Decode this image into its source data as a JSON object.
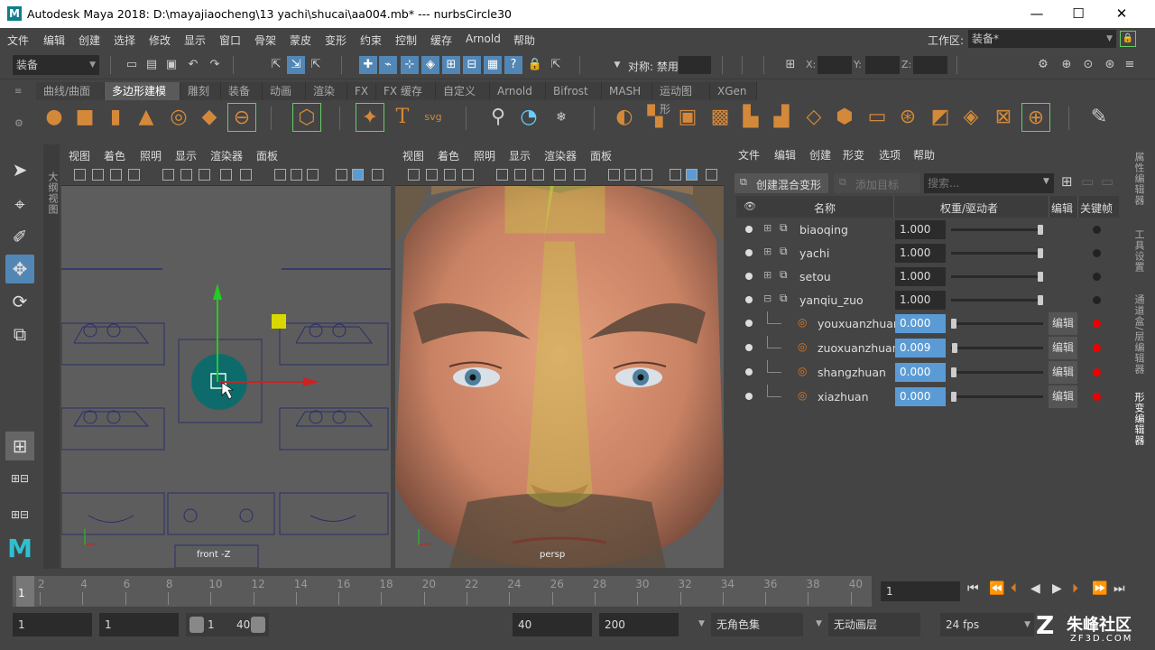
{
  "titlebar": {
    "logo": "M",
    "title": "Autodesk Maya 2018: D:\\mayajiaocheng\\13 yachi\\shucai\\aa004.mb*    ---    nurbsCircle30",
    "minimize": "—",
    "maximize": "☐",
    "close": "✕"
  },
  "menubar": {
    "items": [
      "文件",
      "编辑",
      "创建",
      "选择",
      "修改",
      "显示",
      "窗口",
      "骨架",
      "蒙皮",
      "变形",
      "约束",
      "控制",
      "缓存",
      "Arnold",
      "帮助"
    ],
    "workspace_label": "工作区:",
    "workspace_value": "装备*"
  },
  "statusline": {
    "mode": "装备",
    "symmetry_label": "对称: 禁用",
    "x_label": "X:",
    "y_label": "Y:",
    "z_label": "Z:"
  },
  "shelf": {
    "tabs": [
      "曲线/曲面",
      "多边形建模",
      "雕刻",
      "装备",
      "动画",
      "渲染",
      "FX",
      "FX 缓存",
      "自定义",
      "Arnold",
      "Bifrost",
      "MASH",
      "运动图形",
      "XGen"
    ],
    "active_tab": "多边形建模"
  },
  "viewport_menu": [
    "视图",
    "着色",
    "照明",
    "显示",
    "渲染器",
    "面板"
  ],
  "front_viewport": {
    "camera_label": "front -Z"
  },
  "persp_viewport": {
    "camera_label": "persp"
  },
  "blend_editor": {
    "menu": [
      "文件",
      "编辑",
      "创建",
      "形变",
      "选项",
      "帮助"
    ],
    "create_button": "创建混合变形",
    "add_target_button": "添加目标",
    "search_placeholder": "搜索...",
    "headers": {
      "name": "名称",
      "weight": "权重/驱动者",
      "edit": "编辑",
      "key": "关键帧"
    },
    "rows": [
      {
        "name": "biaoqing",
        "value": "1.000",
        "level": 1.0,
        "has_edit": false,
        "key": "off"
      },
      {
        "name": "yachi",
        "value": "1.000",
        "level": 1.0,
        "has_edit": false,
        "key": "off"
      },
      {
        "name": "setou",
        "value": "1.000",
        "level": 1.0,
        "has_edit": false,
        "key": "off"
      },
      {
        "name": "yanqiu_zuo",
        "value": "1.000",
        "level": 1.0,
        "has_edit": false,
        "key": "off"
      },
      {
        "name": "youxuanzhuan",
        "value": "0.000",
        "level": 0.0,
        "has_edit": true,
        "key": "on"
      },
      {
        "name": "zuoxuanzhuan",
        "value": "0.009",
        "level": 0.009,
        "has_edit": true,
        "key": "on"
      },
      {
        "name": "shangzhuan",
        "value": "0.000",
        "level": 0.0,
        "has_edit": true,
        "key": "on"
      },
      {
        "name": "xiazhuan",
        "value": "0.000",
        "level": 0.0,
        "has_edit": true,
        "key": "on"
      }
    ],
    "edit_label": "编辑"
  },
  "right_tabs": [
    "属性编辑器",
    "工具设置",
    "通道盒/层编辑器",
    "形变编辑器"
  ],
  "left_tab": "大纲视图",
  "timeline": {
    "ticks": [
      "2",
      "4",
      "6",
      "8",
      "10",
      "12",
      "14",
      "16",
      "18",
      "20",
      "22",
      "24",
      "26",
      "28",
      "30",
      "32",
      "34",
      "36",
      "38",
      "40"
    ],
    "current_frame": "1",
    "start_marker": "1"
  },
  "range": {
    "start": "1",
    "playback_start": "1",
    "range_start": "1",
    "range_end": "40",
    "playback_end": "40",
    "end": "200",
    "character_set": "无角色集",
    "anim_layer": "无动画层",
    "fps": "24 fps"
  },
  "watermark": {
    "brand": "朱峰社区",
    "site": "ZF3D.COM"
  }
}
